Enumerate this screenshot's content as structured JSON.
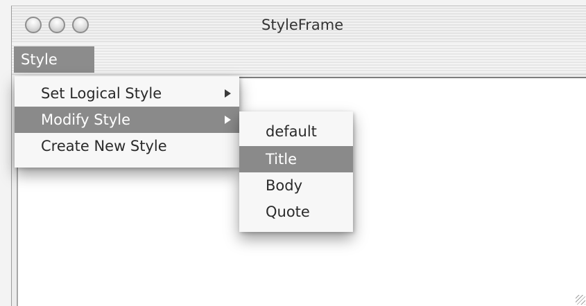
{
  "window": {
    "title": "StyleFrame"
  },
  "menubar": {
    "menus": [
      {
        "label": "Style"
      }
    ]
  },
  "style_menu": {
    "items": [
      {
        "label": "Set Logical Style",
        "has_submenu": true,
        "selected": false
      },
      {
        "label": "Modify Style",
        "has_submenu": true,
        "selected": true
      },
      {
        "label": "Create New Style",
        "has_submenu": false,
        "selected": false
      }
    ]
  },
  "modify_style_submenu": {
    "items": [
      {
        "label": "default",
        "selected": false
      },
      {
        "label": "Title",
        "selected": true
      },
      {
        "label": "Body",
        "selected": false
      },
      {
        "label": "Quote",
        "selected": false
      }
    ]
  },
  "icons": {
    "close": "close-button-icon",
    "minimize": "minimize-button-icon",
    "zoom": "zoom-button-icon",
    "submenu_arrow": "submenu-arrow-icon",
    "resize": "resize-grip-icon"
  },
  "colors": {
    "menu_highlight": "#8a8a8a",
    "highlight_text": "#ffffff",
    "menu_background": "#f7f7f7"
  }
}
